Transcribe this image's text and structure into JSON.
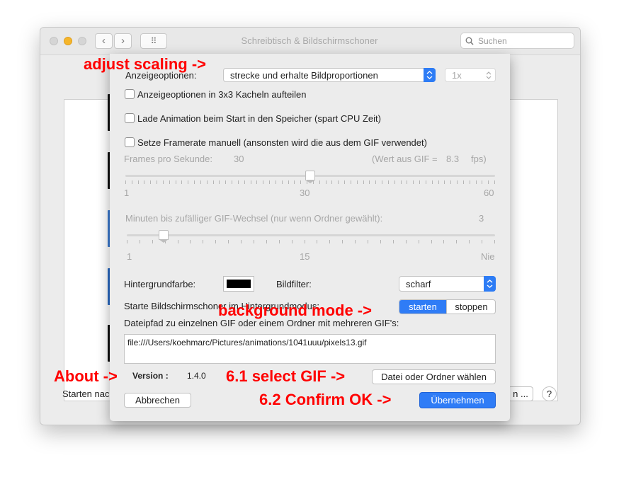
{
  "window": {
    "title": "Schreibtisch & Bildschirmschoner",
    "search_placeholder": "Suchen",
    "nav_back": "‹",
    "nav_forward": "›",
    "grid_icon": "⠿",
    "bottom_left": "Starten nac",
    "bottom_btn": "n ...",
    "help": "?"
  },
  "sheet": {
    "display_options_label": "Anzeigeoptionen:",
    "display_options_value": "strecke und erhalte Bildproportionen",
    "scale_value": "1x",
    "cb_tiles": "Anzeigeoptionen in 3x3 Kacheln aufteilen",
    "cb_preload": "Lade Animation beim Start in den Speicher (spart CPU Zeit)",
    "cb_framerate": "Setze Framerate manuell (ansonsten wird die aus dem GIF verwendet)",
    "fps_label": "Frames pro Sekunde:",
    "fps_value": "30",
    "gif_value_label": "(Wert aus GIF =",
    "gif_value": "8.3",
    "gif_value_unit": "fps)",
    "fps_min": "1",
    "fps_mid": "30",
    "fps_max": "60",
    "fps_slider_fraction": 0.5,
    "minutes_label": "Minuten bis zufälliger GIF-Wechsel (nur wenn Ordner gewählt):",
    "minutes_value": "3",
    "minutes_min": "1",
    "minutes_mid": "15",
    "minutes_max": "Nie",
    "minutes_slider_fraction": 0.1,
    "bg_color_label": "Hintergrundfarbe:",
    "bg_color": "#000000",
    "filter_label": "Bildfilter:",
    "filter_value": "scharf",
    "bg_mode_label": "Starte Bildschirmschoner im Hintergrundmodus:",
    "seg_start": "starten",
    "seg_stop": "stoppen",
    "path_label": "Dateipfad zu einzelnen GIF oder einem Ordner mit mehreren GIF's:",
    "path_value": "file:///Users/koehmarc/Pictures/animations/1041uuu/pixels13.gif",
    "version_label": "Version :",
    "version_value": "1.4.0",
    "choose_button": "Datei oder Ordner wählen",
    "cancel_button": "Abbrechen",
    "apply_button": "Übernehmen"
  },
  "annotations": {
    "scaling": "adjust scaling ->",
    "bg_mode": "background mode ->",
    "about": "About ->",
    "select_gif": "6.1 select GIF ->",
    "confirm": "6.2 Confirm OK ->"
  },
  "colors": {
    "accent": "#2f7cf6",
    "annotation": "#ff0000"
  }
}
